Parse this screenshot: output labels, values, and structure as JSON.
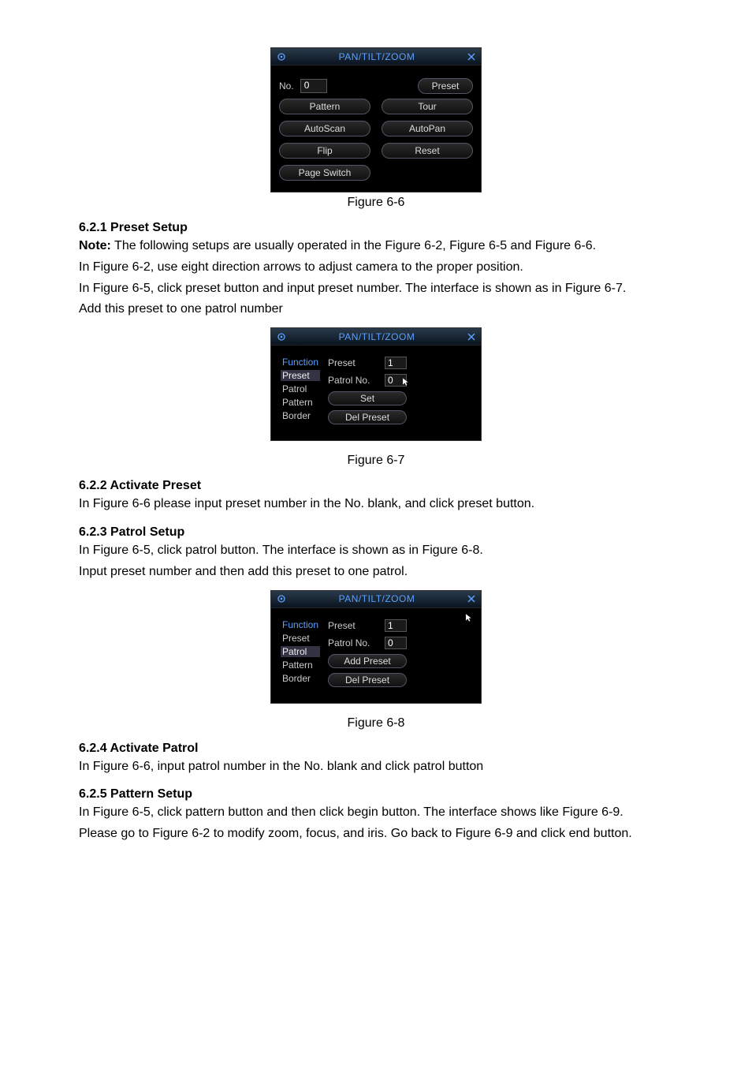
{
  "figures": {
    "f66": "Figure 6-6",
    "f67": "Figure 6-7",
    "f68": "Figure 6-8"
  },
  "panel_title": "PAN/TILT/ZOOM",
  "panel66": {
    "no_label": "No.",
    "no_value": "0",
    "buttons": {
      "preset": "Preset",
      "pattern": "Pattern",
      "tour": "Tour",
      "autoscan": "AutoScan",
      "autopan": "AutoPan",
      "flip": "Flip",
      "reset": "Reset",
      "page_switch": "Page Switch"
    }
  },
  "func_list": [
    "Function",
    "Preset",
    "Patrol",
    "Pattern",
    "Border"
  ],
  "panel67": {
    "preset_label": "Preset",
    "preset_value": "1",
    "patrolno_label": "Patrol No.",
    "patrolno_value": "0",
    "set_btn": "Set",
    "del_btn": "Del Preset"
  },
  "panel68": {
    "preset_label": "Preset",
    "preset_value": "1",
    "patrolno_label": "Patrol No.",
    "patrolno_value": "0",
    "add_btn": "Add Preset",
    "del_btn": "Del Preset"
  },
  "headings": {
    "h621": "6.2.1  Preset Setup",
    "h622": "6.2.2  Activate Preset",
    "h623": "6.2.3  Patrol Setup",
    "h624": "6.2.4  Activate Patrol",
    "h625": "6.2.5  Pattern Setup"
  },
  "text": {
    "note_label": "Note:",
    "p621_1": " The following setups are usually operated in the Figure 6-2, Figure 6-5 and Figure 6-6.",
    "p621_2": "In Figure 6-2, use eight direction arrows to adjust camera to the proper position.",
    "p621_3": "In Figure 6-5, click preset button and input preset number. The interface is shown as in Figure 6-7.",
    "p621_4": "Add this preset to one patrol number",
    "p622_1": "In Figure 6-6 please input preset number in the No. blank, and click preset button.",
    "p623_1": "In Figure 6-5, click patrol button. The interface is shown as in Figure 6-8.",
    "p623_2": "Input preset number and then add this preset to one patrol.",
    "p624_1": "In Figure 6-6, input patrol number in the No. blank and click patrol button",
    "p625_1": "In Figure 6-5, click pattern button and then click begin button. The interface shows like Figure 6-9.",
    "p625_2": "Please go to Figure 6-2 to modify zoom, focus, and iris.  Go back to Figure 6-9 and click end button."
  }
}
